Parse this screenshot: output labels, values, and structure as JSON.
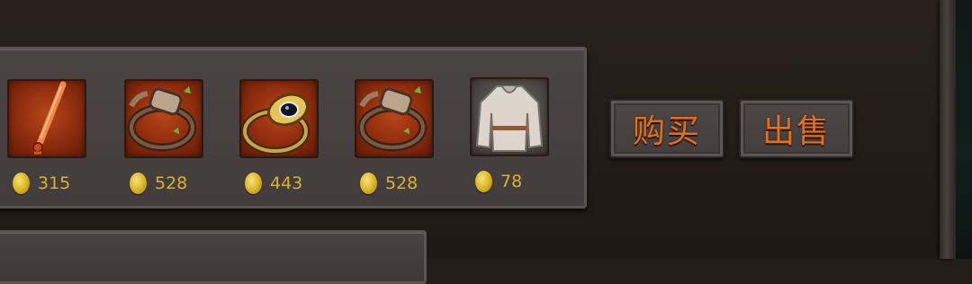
{
  "shop": {
    "items": [
      {
        "icon": "staff-icon",
        "price": "315"
      },
      {
        "icon": "bracelet-icon",
        "price": "528"
      },
      {
        "icon": "ring-icon",
        "price": "443"
      },
      {
        "icon": "bracelet-icon",
        "price": "528"
      },
      {
        "icon": "tunic-icon",
        "price": "78"
      }
    ],
    "buy_label": "购买",
    "sell_label": "出售"
  },
  "colors": {
    "price_text": "#d7b42a",
    "button_text": "#e0711b",
    "slot_bg": "#8a2a0c"
  }
}
